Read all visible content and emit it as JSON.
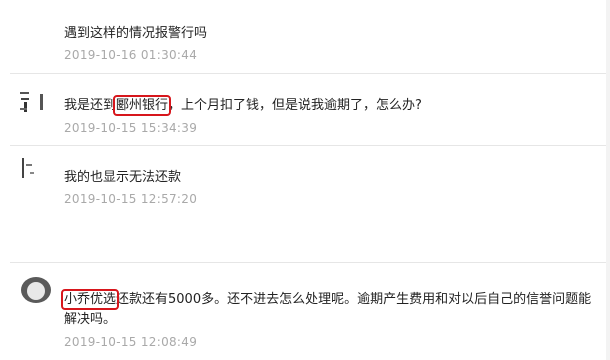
{
  "comments": [
    {
      "username": "",
      "text": "遇到这样的情况报警行吗",
      "time": "2019-10-16 01:30:44"
    },
    {
      "username": "",
      "text_before": "我是还到",
      "highlight": "郾州银行",
      "text_after": "，上个月扣了钱，但是说我逾期了，怎么办?",
      "time": "2019-10-15 15:34:39"
    },
    {
      "username": "",
      "text": "我的也显示无法还款",
      "time": "2019-10-15 12:57:20"
    },
    {
      "username": "",
      "highlight": "小乔优选",
      "text_after": "还款还有5000多。还不进去怎么处理呢。逾期产生费用和对以后自己的信誉问题能解决吗。",
      "time": "2019-10-15 12:08:49"
    }
  ],
  "colors": {
    "highlight_border": "#d7161c",
    "timestamp": "#a9a9a9",
    "divider": "#e6e6e6"
  }
}
